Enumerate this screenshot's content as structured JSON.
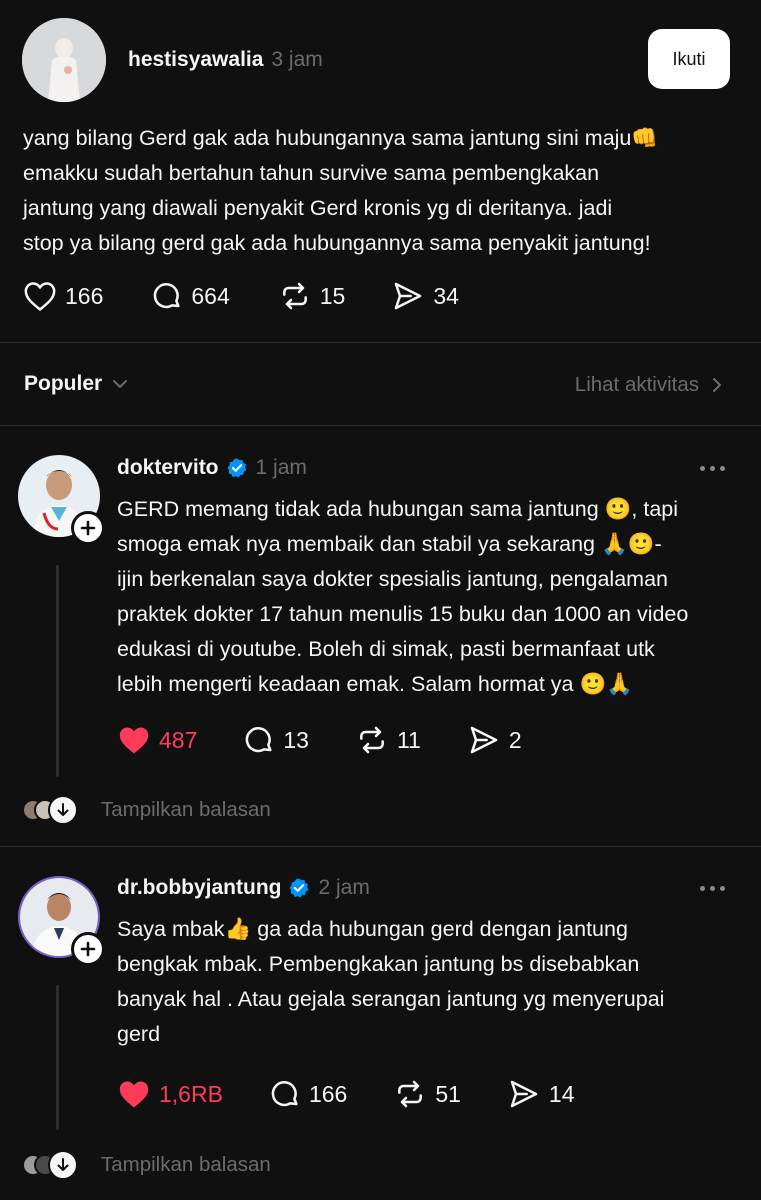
{
  "post": {
    "username": "hestisyawalia",
    "time": "3 jam",
    "follow_label": "Ikuti",
    "lines": [
      "yang bilang Gerd gak ada hubungannya sama jantung sini maju👊",
      "emakku sudah bertahun tahun survive sama pembengkakan",
      "jantung yang diawali penyakit Gerd kronis yg di deritanya. jadi",
      "stop ya bilang gerd gak ada hubungannya sama penyakit jantung!"
    ],
    "likes": "166",
    "comments": "664",
    "reposts": "15",
    "shares": "34"
  },
  "sort": {
    "label": "Populer",
    "activity_label": "Lihat aktivitas"
  },
  "replies": [
    {
      "username": "doktervito",
      "time": "1 jam",
      "lines": [
        "GERD memang tidak ada hubungan sama jantung 🙂, tapi",
        "smoga emak nya membaik dan stabil ya sekarang 🙏🙂-",
        "ijin berkenalan saya dokter spesialis jantung, pengalaman",
        "praktek dokter 17 tahun menulis 15 buku dan 1000 an video",
        "edukasi di youtube. Boleh di simak, pasti bermanfaat utk",
        "lebih mengerti keadaan emak. Salam hormat ya 🙂🙏"
      ],
      "likes": "487",
      "comments": "13",
      "reposts": "11",
      "shares": "2",
      "show_replies": "Tampilkan balasan"
    },
    {
      "username": "dr.bobbyjantung",
      "time": "2 jam",
      "lines": [
        "Saya mbak👍 ga ada hubungan gerd dengan jantung",
        "bengkak mbak.  Pembengkakan jantung bs disebabkan",
        "banyak hal . Atau gejala serangan jantung yg menyerupai",
        "gerd"
      ],
      "likes": "1,6RB",
      "comments": "166",
      "reposts": "51",
      "shares": "14",
      "show_replies": "Tampilkan balasan"
    }
  ],
  "colors": {
    "background": "#101010",
    "like_active": "#ff3b5c",
    "verified": "#0095f6",
    "muted": "#6c6c6c"
  }
}
